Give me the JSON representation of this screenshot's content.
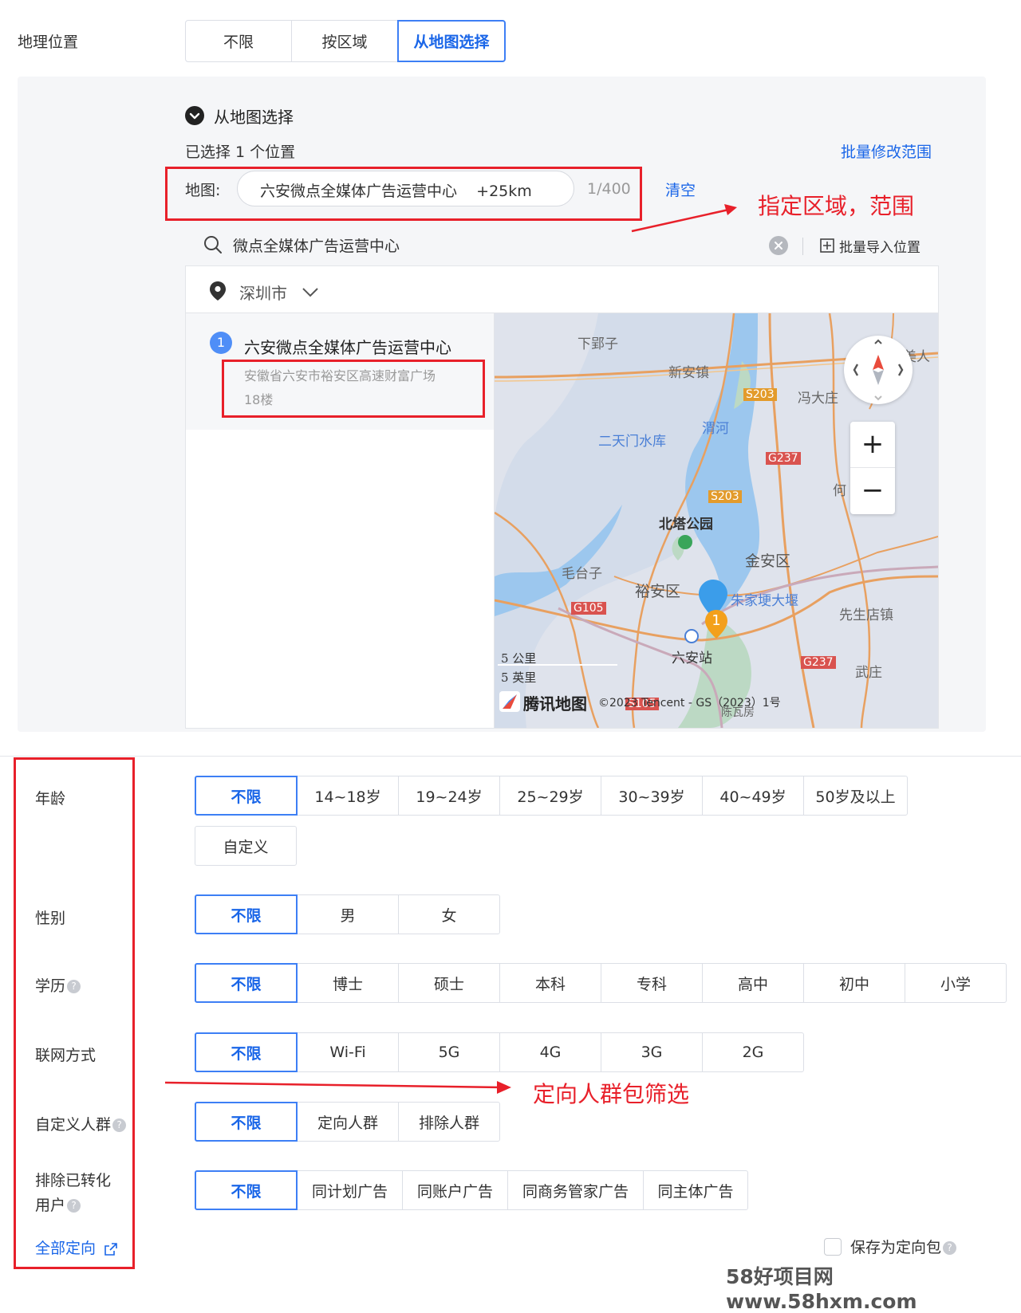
{
  "location": {
    "label": "地理位置",
    "options": [
      "不限",
      "按区域",
      "从地图选择"
    ],
    "active_index": 2
  },
  "map_select": {
    "title": "从地图选择",
    "selected_count_text": "已选择 1 个位置",
    "batch_modify": "批量修改范围",
    "map_label": "地图:",
    "chip_text": "六安微点全媒体广告运营中心    +25km",
    "counter": "1/400",
    "clear": "清空",
    "search_value": "微点全媒体广告运营中心",
    "batch_import": "批量导入位置",
    "city": "深圳市",
    "result_index": "1",
    "result_name": "六安微点全媒体广告运营中心",
    "result_address_line1": "安徽省六安市裕安区高速财富广场",
    "result_address_line2": "18楼"
  },
  "map": {
    "place_labels": [
      "下郢子",
      "新安镇",
      "S203",
      "冯大庄",
      "美人",
      "渭河",
      "二天门水库",
      "G237",
      "S203",
      "何",
      "北塔公园",
      "金安区",
      "毛台子",
      "裕安区",
      "朱家埂大堰",
      "先生店镇",
      "G105",
      "六安站",
      "G237",
      "武庄",
      "S105",
      "陈瓦房"
    ],
    "marker_index": "1",
    "scale_km": "5 公里",
    "scale_mi": "5 英里",
    "brand": "腾讯地图",
    "copyright": "©2023 Tencent - GS（2023）1号",
    "zoom_in": "+",
    "zoom_out": "−"
  },
  "annotations": {
    "region_note": "指定区域，范围",
    "crowd_note": "定向人群包筛选"
  },
  "targeting": {
    "age": {
      "label": "年龄",
      "options": [
        "不限",
        "14~18岁",
        "19~24岁",
        "25~29岁",
        "30~39岁",
        "40~49岁",
        "50岁及以上"
      ],
      "custom": "自定义"
    },
    "gender": {
      "label": "性别",
      "options": [
        "不限",
        "男",
        "女"
      ]
    },
    "education": {
      "label": "学历",
      "options": [
        "不限",
        "博士",
        "硕士",
        "本科",
        "专科",
        "高中",
        "初中",
        "小学"
      ]
    },
    "network": {
      "label": "联网方式",
      "options": [
        "不限",
        "Wi-Fi",
        "5G",
        "4G",
        "3G",
        "2G"
      ]
    },
    "custom_crowd": {
      "label": "自定义人群",
      "options": [
        "不限",
        "定向人群",
        "排除人群"
      ]
    },
    "exclude": {
      "label_line1": "排除已转化",
      "label_line2": "用户",
      "options": [
        "不限",
        "同计划广告",
        "同账户广告",
        "同商务管家广告",
        "同主体广告"
      ]
    },
    "all_targeting": "全部定向",
    "save_package": "保存为定向包"
  },
  "watermark": "58好项目网www.58hxm.com",
  "colors": {
    "accent": "#1a66e8",
    "annotation_red": "#e8202a",
    "panel_bg": "#f5f6f8"
  }
}
